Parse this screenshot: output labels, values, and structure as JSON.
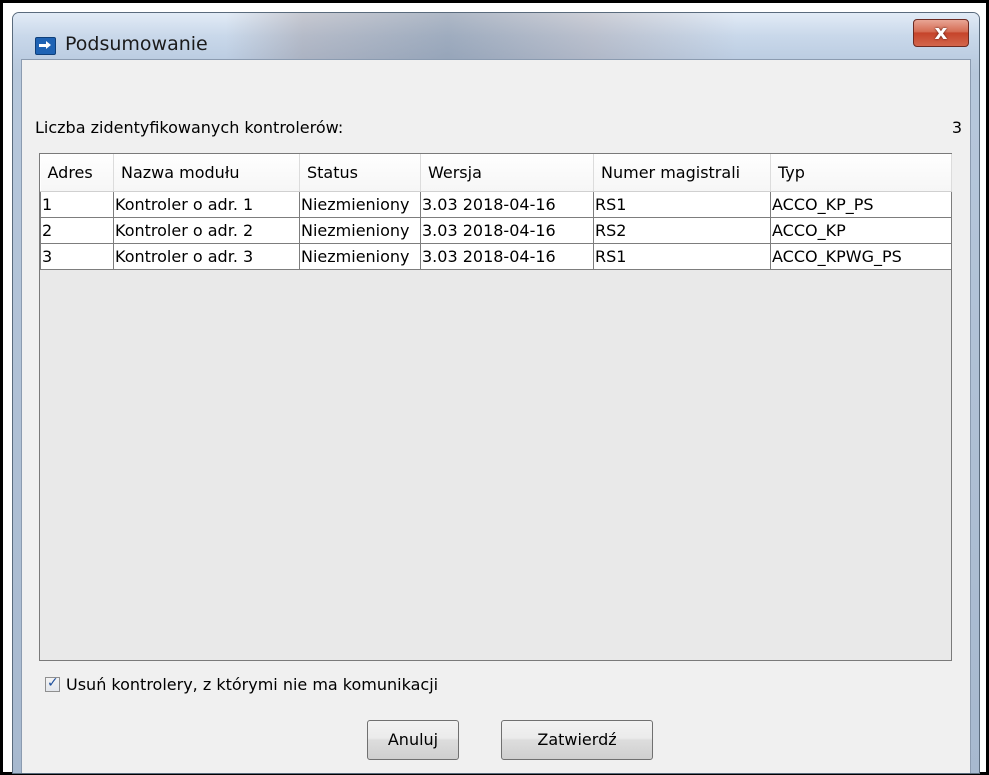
{
  "window": {
    "title": "Podsumowanie",
    "close_label": "x"
  },
  "summary": {
    "label": "Liczba zidentyfikowanych kontrolerów:",
    "count": "3"
  },
  "table": {
    "columns": [
      "Adres",
      "Nazwa modułu",
      "Status",
      "Wersja",
      "Numer magistrali",
      "Typ"
    ],
    "rows": [
      [
        "1",
        "Kontroler o adr. 1",
        "Niezmieniony",
        "3.03 2018-04-16",
        "RS1",
        "ACCO_KP_PS"
      ],
      [
        "2",
        "Kontroler o adr. 2",
        "Niezmieniony",
        "3.03 2018-04-16",
        "RS2",
        "ACCO_KP"
      ],
      [
        "3",
        "Kontroler o adr. 3",
        "Niezmieniony",
        "3.03 2018-04-16",
        "RS1",
        "ACCO_KPWG_PS"
      ]
    ]
  },
  "options": {
    "remove_label": "Usuń kontrolery, z którymi nie ma komunikacji",
    "remove_checked": true
  },
  "buttons": {
    "cancel": "Anuluj",
    "confirm": "Zatwierdź"
  },
  "icons": {
    "app": "app-window-icon",
    "close": "close-icon",
    "check": "checkmark-icon"
  }
}
